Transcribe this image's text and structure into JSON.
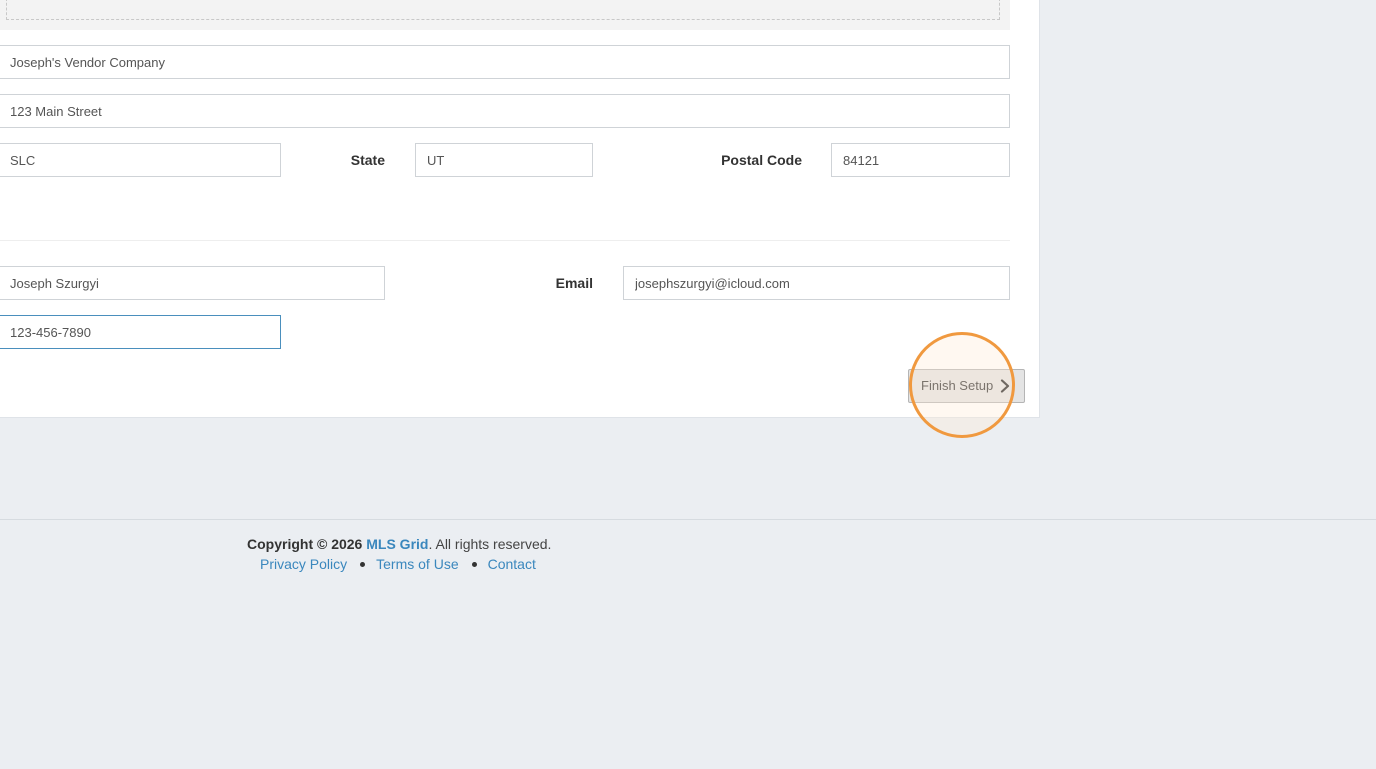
{
  "form": {
    "company_name": "Joseph's Vendor Company",
    "address": "123 Main Street",
    "city": "SLC",
    "state_label": "State",
    "state": "UT",
    "postal_label": "Postal Code",
    "postal_code": "84121",
    "contact_name": "Joseph Szurgyi",
    "email_label": "Email",
    "email": "josephszurgyi@icloud.com",
    "phone": "123-456-7890",
    "finish_label": "Finish Setup"
  },
  "footer": {
    "copyright_prefix": "Copyright © 2026",
    "brand": "MLS Grid",
    "copyright_suffix": ". All rights reserved.",
    "links": [
      "Privacy Policy",
      "Terms of Use",
      "Contact"
    ]
  },
  "colors": {
    "accent": "#3a87bd",
    "highlight": "#f0993f",
    "background": "#ebeef2"
  },
  "icons": {
    "finish": "chevron-right-icon"
  }
}
